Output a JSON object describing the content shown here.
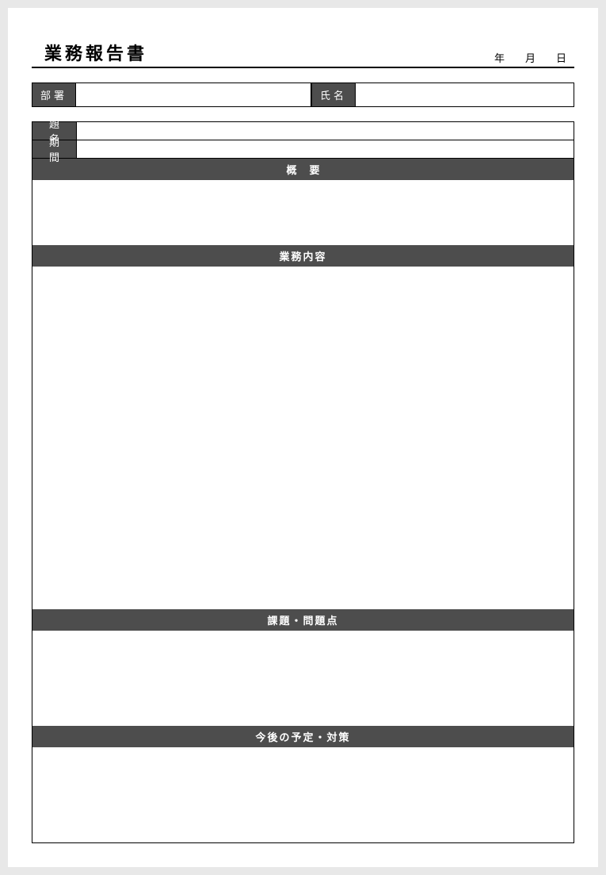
{
  "header": {
    "title": "業務報告書",
    "date_year_label": "年",
    "date_month_label": "月",
    "date_day_label": "日"
  },
  "id_row": {
    "department_label": "部署",
    "department_value": "",
    "name_label": "氏名",
    "name_value": ""
  },
  "form": {
    "subject_label": "題名",
    "subject_value": "",
    "period_label": "期間",
    "period_value": ""
  },
  "sections": {
    "summary_label": "概要",
    "summary_value": "",
    "work_label": "業務内容",
    "work_value": "",
    "issues_label": "課題・問題点",
    "issues_value": "",
    "plan_label": "今後の予定・対策",
    "plan_value": ""
  }
}
